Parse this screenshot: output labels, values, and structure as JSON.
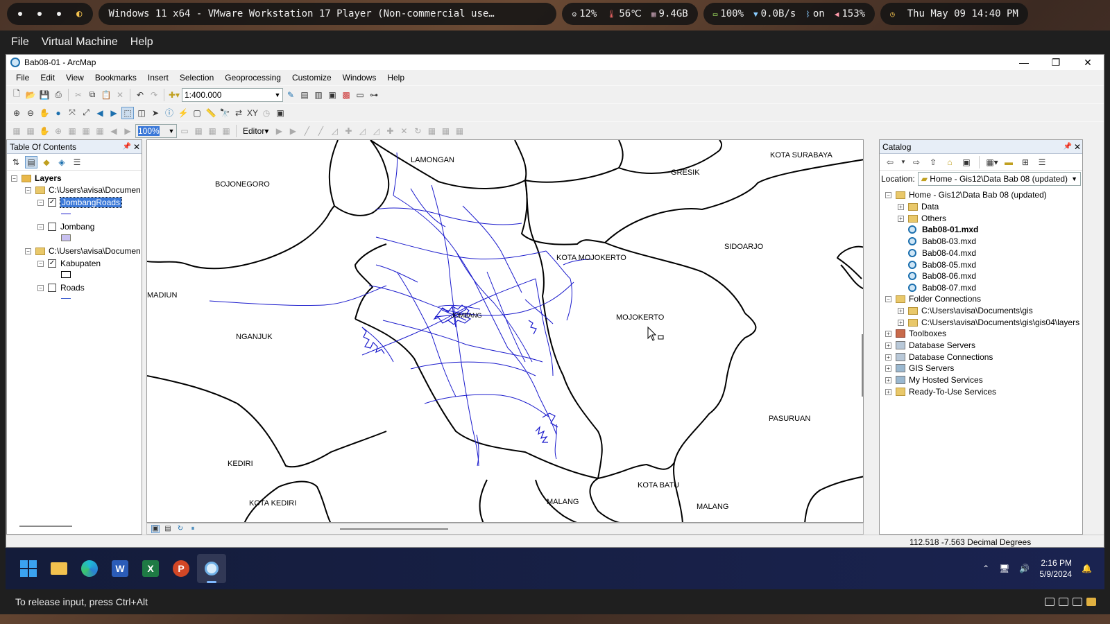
{
  "topbar": {
    "vm_title": "Windows 11 x64 - VMware Workstation 17 Player (Non-commercial use…",
    "cpu": "12%",
    "temp": "56℃",
    "mem": "9.4GB",
    "battery": "100%",
    "net": "0.0B/s",
    "bluetooth": "on",
    "volume": "153%",
    "datetime": "Thu May 09 14:40 PM"
  },
  "vmware": {
    "menu": [
      "File",
      "Virtual Machine",
      "Help"
    ],
    "status": "To release input, press Ctrl+Alt"
  },
  "arcmap": {
    "title": "Bab08-01 - ArcMap",
    "menu": [
      "File",
      "Edit",
      "View",
      "Bookmarks",
      "Insert",
      "Selection",
      "Geoprocessing",
      "Customize",
      "Windows",
      "Help"
    ],
    "scale": "1:400.000",
    "zoom": "100%",
    "editor_label": "Editor▾"
  },
  "toc": {
    "title": "Table Of Contents",
    "root": "Layers",
    "group1": "C:\\Users\\avisa\\Documen",
    "layer1": "JombangRoads",
    "layer2": "Jombang",
    "group2": "C:\\Users\\avisa\\Documen",
    "layer3": "Kabupaten",
    "layer4": "Roads"
  },
  "map": {
    "labels": [
      "LAMONGAN",
      "KOTA SURABAYA",
      "GRESIK",
      "BOJONEGORO",
      "KOTA MOJOKERTO",
      "SIDOARJO",
      "MADIUN",
      "MOJOKERTO",
      "NGANJUK",
      "PASURUAN",
      "KEDIRI",
      "KOTA BATU",
      "KOTA KEDIRI",
      "MALANG",
      "MALANG",
      "JOMBANG"
    ],
    "colors": {
      "roads": "#1a1acc",
      "boundary": "#000000"
    }
  },
  "catalog": {
    "title": "Catalog",
    "location_label": "Location:",
    "location_value": "Home - Gis12\\Data Bab 08 (updated)",
    "home": "Home - Gis12\\Data Bab 08 (updated)",
    "items": [
      "Data",
      "Others"
    ],
    "mxds": [
      "Bab08-01.mxd",
      "Bab08-03.mxd",
      "Bab08-04.mxd",
      "Bab08-05.mxd",
      "Bab08-06.mxd",
      "Bab08-07.mxd"
    ],
    "folder_connections": "Folder Connections",
    "fc1": "C:\\Users\\avisa\\Documents\\gis",
    "fc2": "C:\\Users\\avisa\\Documents\\gis\\gis04\\layers",
    "others": [
      "Toolboxes",
      "Database Servers",
      "Database Connections",
      "GIS Servers",
      "My Hosted Services",
      "Ready-To-Use Services"
    ]
  },
  "status": {
    "coords": "112.518  -7.563 Decimal Degrees"
  },
  "taskbar": {
    "time": "2:16 PM",
    "date": "5/9/2024"
  }
}
